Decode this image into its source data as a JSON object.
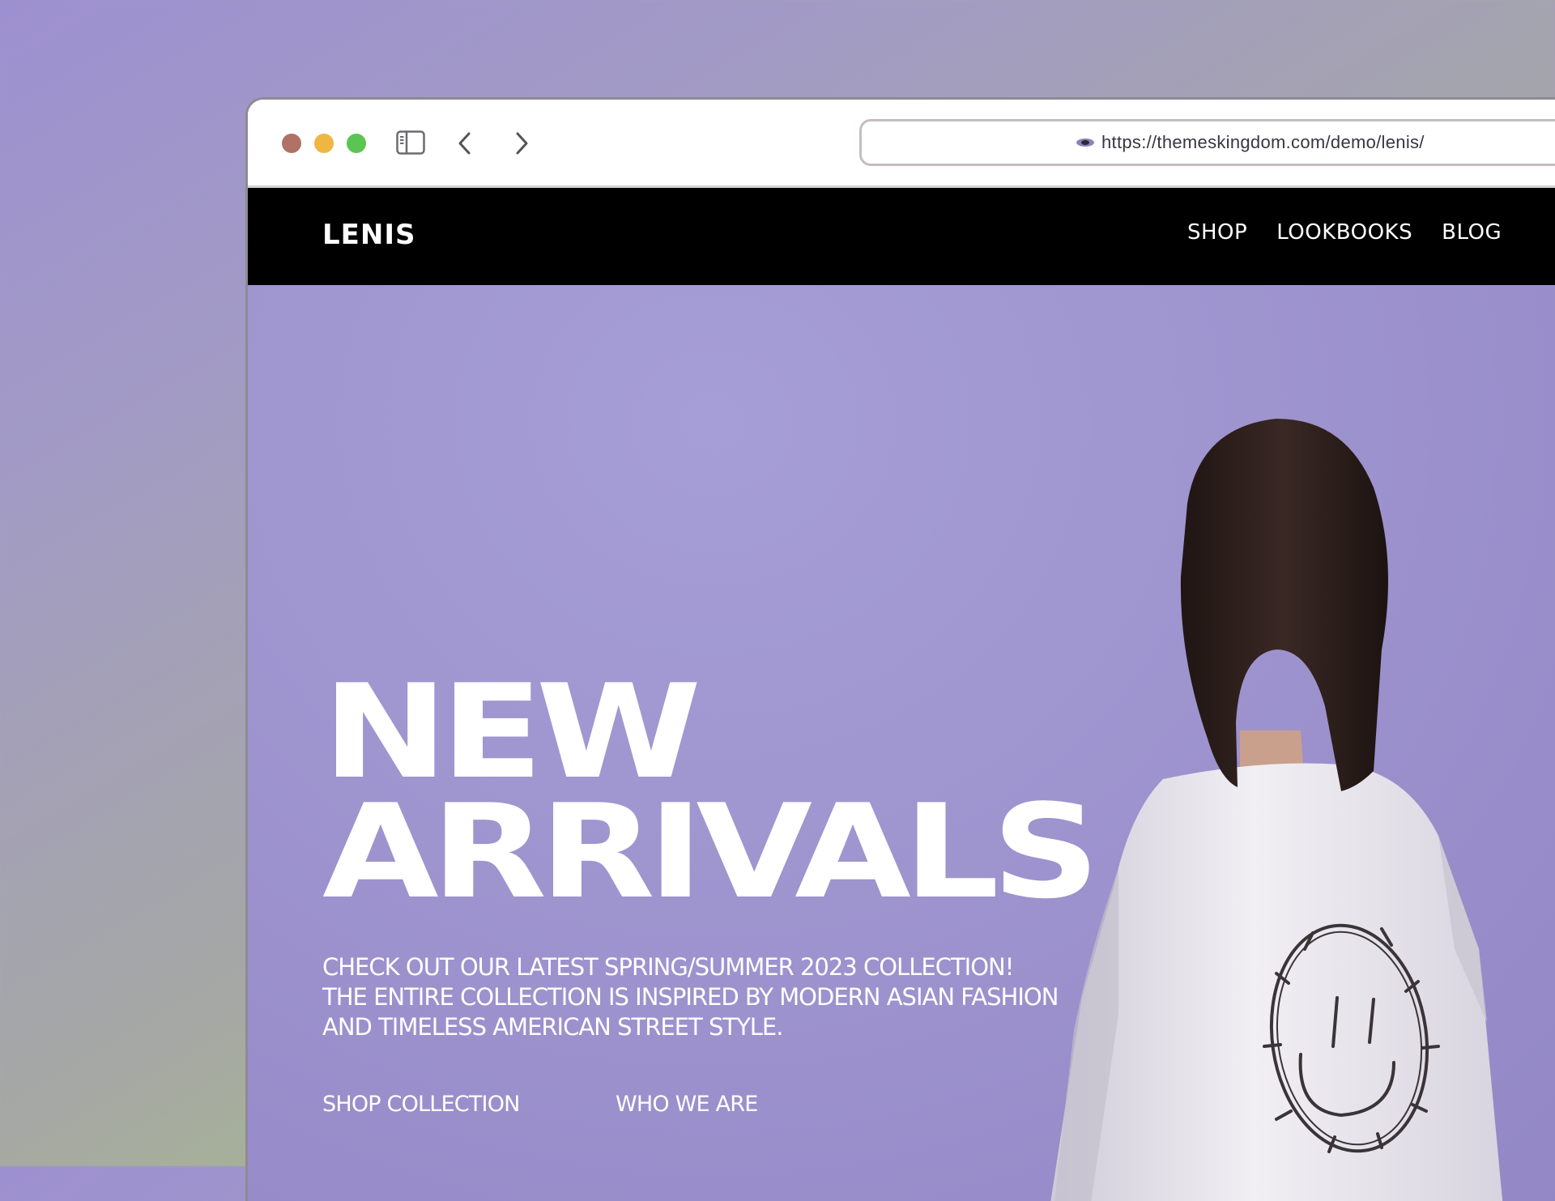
{
  "browser": {
    "url": "https://themeskingdom.com/demo/lenis/",
    "icons": {
      "sidebar": "sidebar-toggle-icon",
      "back": "chevron-left-icon",
      "forward": "chevron-right-icon",
      "site": "site-favicon-icon"
    }
  },
  "site": {
    "logo": "LENIS",
    "menu": [
      "SHOP",
      "LOOKBOOKS",
      "BLOG"
    ]
  },
  "hero": {
    "headline_line1": "NEW",
    "headline_line2": "ARRIVALS",
    "subtext_lines": [
      "CHECK OUT OUR LATEST SPRING/SUMMER 2023 COLLECTION!",
      "THE ENTIRE COLLECTION IS INSPIRED BY MODERN ASIAN FASHION",
      "AND TIMELESS AMERICAN STREET STYLE."
    ],
    "cta_primary": "SHOP COLLECTION",
    "cta_secondary": "WHO WE ARE"
  },
  "colors": {
    "hero_bg": "#9d94d0",
    "nav_bg": "#000000",
    "text": "#ffffff",
    "traffic_red": "#b07166",
    "traffic_yellow": "#f0b642",
    "traffic_green": "#5ac552"
  }
}
